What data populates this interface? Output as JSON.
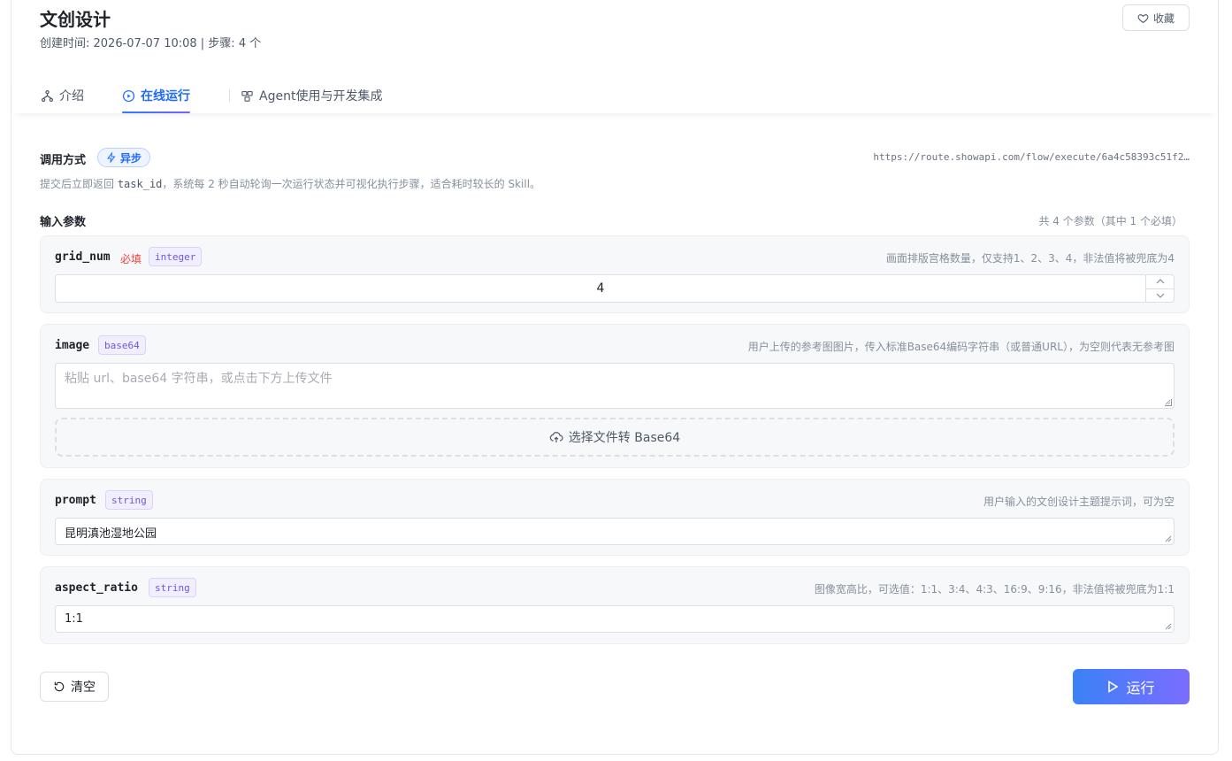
{
  "header": {
    "title": "文创设计",
    "meta": "创建时间: 2026-07-07 10:08 | 步骤: 4 个",
    "favorite_label": "收藏"
  },
  "tabs": [
    {
      "label": "介绍",
      "icon": "flow-icon"
    },
    {
      "label": "在线运行",
      "icon": "play-circle-icon",
      "active": true
    },
    {
      "label": "Agent使用与开发集成",
      "icon": "api-icon"
    }
  ],
  "invoke": {
    "label": "调用方式",
    "mode": "异步",
    "url": "https://route.showapi.com/flow/execute/6a4c58393c51f2…",
    "desc_before": "提交后立即返回 ",
    "desc_code": "task_id",
    "desc_after": "，系统每 2 秒自动轮询一次运行状态并可视化执行步骤，适合耗时较长的 Skill。"
  },
  "params": {
    "label": "输入参数",
    "count_text": "共 4 个参数（其中 1 个必填）",
    "items": [
      {
        "name": "grid_num",
        "required": "必填",
        "type": "integer",
        "desc": "画面排版宫格数量，仅支持1、2、3、4，非法值将被兜底为4",
        "value": "4"
      },
      {
        "name": "image",
        "type": "base64",
        "desc": "用户上传的参考图图片，传入标准Base64编码字符串（或普通URL），为空则代表无参考图",
        "placeholder": "粘贴 url、base64 字符串，或点击下方上传文件",
        "upload_label": "选择文件转 Base64"
      },
      {
        "name": "prompt",
        "type": "string",
        "desc": "用户输入的文创设计主题提示词，可为空",
        "value": "昆明滇池湿地公园"
      },
      {
        "name": "aspect_ratio",
        "type": "string",
        "desc": "图像宽高比，可选值：1:1、3:4、4:3、16:9、9:16，非法值将被兜底为1:1",
        "value": "1:1"
      }
    ]
  },
  "actions": {
    "clear_label": "清空",
    "run_label": "运行"
  },
  "colors": {
    "accent": "#1f6bff",
    "required": "#f53f3f",
    "type_badge": "#6b5bd6"
  }
}
